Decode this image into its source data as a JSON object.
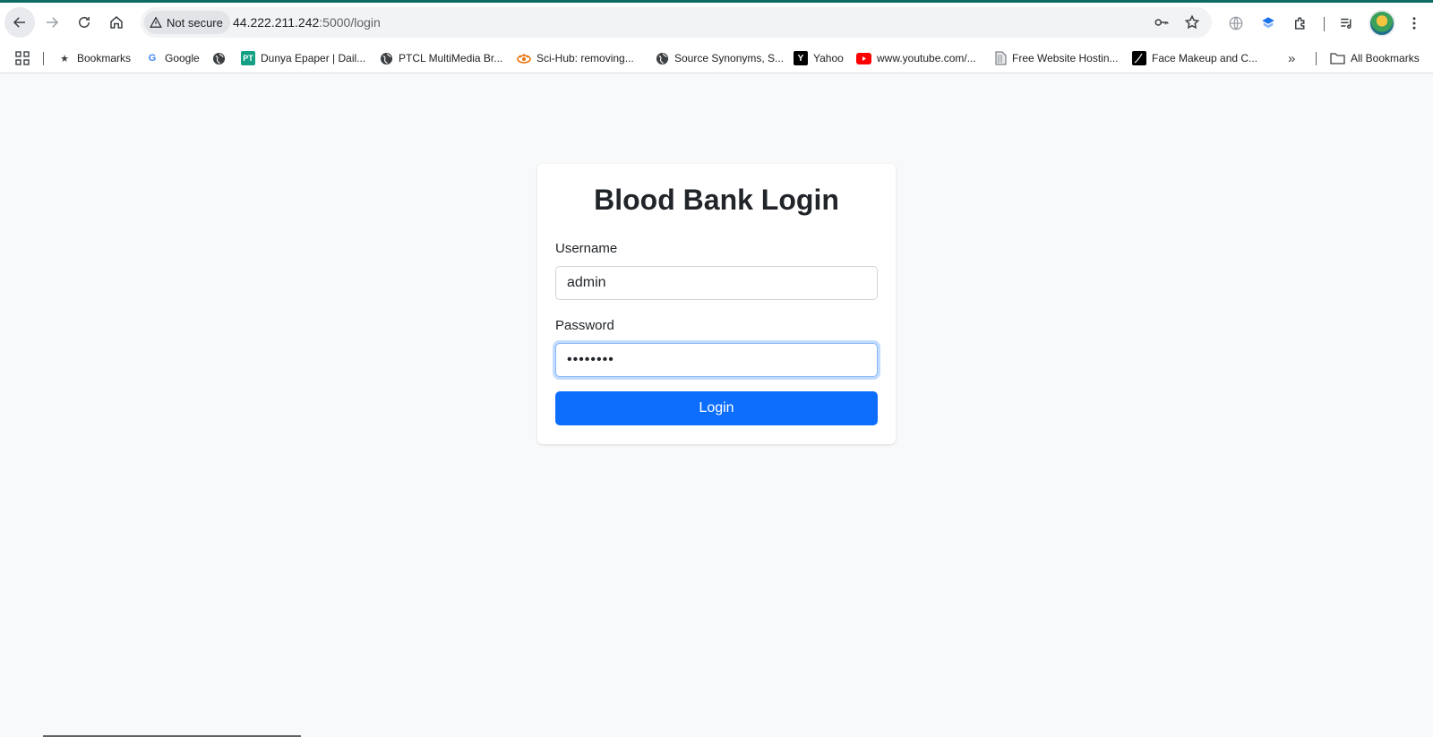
{
  "browser": {
    "security_label": "Not secure",
    "url_host": "44.222.211.242",
    "url_path": ":5000/login",
    "icons": [
      "back-arrow-icon",
      "forward-arrow-icon",
      "reload-icon",
      "home-icon",
      "warning-icon",
      "key-icon",
      "star-icon",
      "translate-icon",
      "extension-shield-icon",
      "puzzle-icon",
      "media-queue-icon",
      "menu-dots-icon"
    ]
  },
  "bookmarks": {
    "items": [
      {
        "label": "Bookmarks",
        "icon": "star-icon"
      },
      {
        "label": "Google",
        "icon": "google-icon"
      },
      {
        "label": "",
        "icon": "globe-icon"
      },
      {
        "label": "Dunya Epaper | Dail...",
        "icon": "pt-icon"
      },
      {
        "label": "PTCL MultiMedia Br...",
        "icon": "globe-icon"
      },
      {
        "label": "Sci-Hub: removing...",
        "icon": "scihub-icon"
      },
      {
        "label": "Source Synonyms, S...",
        "icon": "globe-icon"
      },
      {
        "label": "Yahoo",
        "icon": "yahoo-icon"
      },
      {
        "label": "www.youtube.com/...",
        "icon": "youtube-icon"
      },
      {
        "label": "Free Website Hostin...",
        "icon": "file-icon"
      },
      {
        "label": "Face Makeup and C...",
        "icon": "face-makeup-icon"
      }
    ],
    "overflow": "»",
    "all_bookmarks": "All Bookmarks"
  },
  "login": {
    "title": "Blood Bank Login",
    "username_label": "Username",
    "username_value": "admin",
    "password_label": "Password",
    "password_value": "12345678",
    "submit_label": "Login"
  },
  "colors": {
    "accent": "#0d6efd",
    "page_bg": "#f8f9fa",
    "card_bg": "#ffffff"
  }
}
